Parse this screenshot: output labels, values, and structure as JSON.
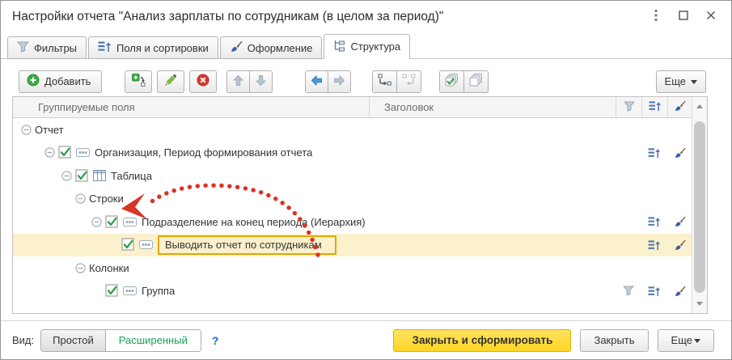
{
  "window": {
    "title": "Настройки отчета \"Анализ зарплаты по сотрудникам (в целом за период)\"",
    "controls": [
      {
        "name": "window-menu",
        "icon": "kebab-icon"
      },
      {
        "name": "maximize",
        "icon": "maximize-icon"
      },
      {
        "name": "close",
        "icon": "close-icon"
      }
    ]
  },
  "tabs": [
    {
      "label": "Фильтры",
      "icon": "funnel-icon",
      "active": false
    },
    {
      "label": "Поля и сортировки",
      "icon": "fields-sort-icon",
      "active": false
    },
    {
      "label": "Оформление",
      "icon": "brush-icon",
      "active": false
    },
    {
      "label": "Структура",
      "icon": "structure-icon",
      "active": true
    }
  ],
  "toolbar": {
    "add_label": "Добавить",
    "more_label": "Еще",
    "buttons": [
      {
        "name": "add",
        "icon": "plus-circle-icon",
        "enabled": true
      },
      {
        "name": "add-group",
        "icon": "add-group-icon",
        "enabled": true
      },
      {
        "name": "edit",
        "icon": "pencil-icon",
        "enabled": true
      },
      {
        "name": "delete",
        "icon": "delete-icon",
        "enabled": true
      },
      {
        "name": "move-up",
        "icon": "arrow-up-icon",
        "enabled": false
      },
      {
        "name": "move-down",
        "icon": "arrow-down-icon",
        "enabled": false
      },
      {
        "name": "move-left",
        "icon": "arrow-left-icon",
        "enabled": true
      },
      {
        "name": "move-right",
        "icon": "arrow-right-icon",
        "enabled": false
      },
      {
        "name": "group",
        "icon": "group-icon",
        "enabled": true
      },
      {
        "name": "ungroup",
        "icon": "ungroup-icon",
        "enabled": false
      },
      {
        "name": "check-all",
        "icon": "check-all-icon",
        "enabled": true
      },
      {
        "name": "uncheck-all",
        "icon": "uncheck-all-icon",
        "enabled": true
      }
    ]
  },
  "table": {
    "headers": {
      "group_fields": "Группируемые поля",
      "title": "Заголовок"
    },
    "header_icons": [
      "filter-icon",
      "fields-sort-icon",
      "brush-icon"
    ],
    "rows": [
      {
        "label": "Отчет",
        "level": 0,
        "expander": true,
        "checked": null,
        "type_icon": null,
        "filter": false,
        "sort": false,
        "brush": false,
        "selected": false
      },
      {
        "label": "Организация, Период формирования отчета",
        "level": 1,
        "expander": true,
        "checked": true,
        "type_icon": "fields-badge-icon",
        "filter": false,
        "sort": true,
        "brush": true,
        "selected": false
      },
      {
        "label": "Таблица",
        "level": 2,
        "expander": true,
        "checked": true,
        "type_icon": "table-icon",
        "filter": false,
        "sort": false,
        "brush": false,
        "selected": false
      },
      {
        "label": "Строки",
        "level": 3,
        "expander": true,
        "checked": null,
        "type_icon": null,
        "filter": false,
        "sort": false,
        "brush": false,
        "selected": false
      },
      {
        "label": "Подразделение на конец периода (Иерархия)",
        "level": 4,
        "expander": true,
        "checked": true,
        "type_icon": "fields-badge-icon",
        "filter": false,
        "sort": true,
        "brush": true,
        "selected": false
      },
      {
        "label": "Выводить отчет по сотрудникам",
        "level": 5,
        "expander": false,
        "checked": true,
        "type_icon": "fields-badge-icon",
        "filter": false,
        "sort": true,
        "brush": true,
        "selected": true
      },
      {
        "label": "Колонки",
        "level": 3,
        "expander": true,
        "checked": null,
        "type_icon": null,
        "filter": false,
        "sort": false,
        "brush": false,
        "selected": false
      },
      {
        "label": "Группа",
        "level": 4,
        "expander": false,
        "checked": true,
        "type_icon": "fields-badge-icon",
        "filter": true,
        "sort": true,
        "brush": true,
        "selected": false
      }
    ]
  },
  "annotation": {
    "type": "red-dotted-arrow",
    "from_row": "Выводить отчет по сотрудникам",
    "to_row": "Строки",
    "color": "#d93425"
  },
  "footer": {
    "view_label": "Вид:",
    "view_options": [
      {
        "label": "Простой",
        "active": false
      },
      {
        "label": "Расширенный",
        "active": true
      }
    ],
    "help_label": "?",
    "close_generate_label": "Закрыть и сформировать",
    "close_label": "Закрыть",
    "more_label": "Еще"
  },
  "colors": {
    "selection_bg": "#fbf1cd",
    "selection_border": "#e2a600",
    "check_green": "#2f9e44",
    "arrow_red": "#d93425",
    "primary_button_yellow": "#ffd524",
    "advanced_green": "#19a15c",
    "help_blue": "#0b6fce"
  }
}
